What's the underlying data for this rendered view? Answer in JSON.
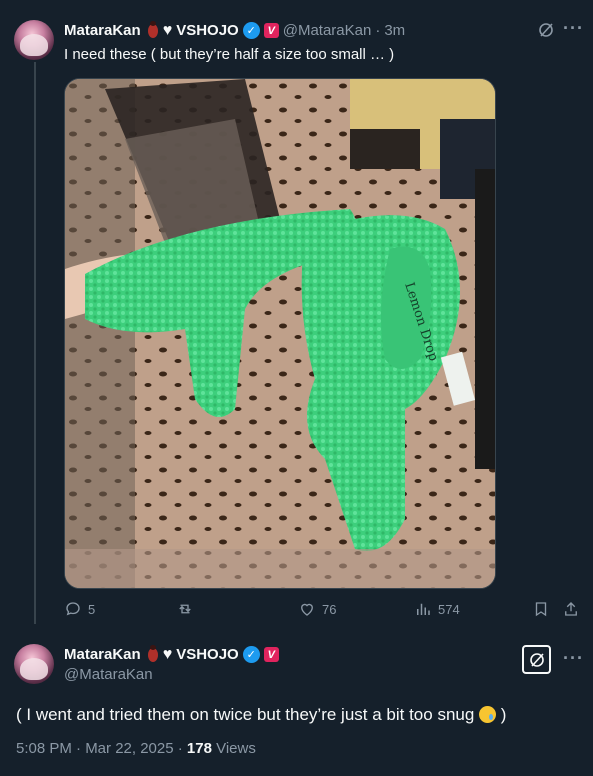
{
  "tweet1": {
    "display_name": "MataraKan",
    "affiliation": "VSHOJO",
    "handle": "@MataraKan",
    "separator": "·",
    "time_ago": "3m",
    "text": "I need these ( but they’re half a size too small … )",
    "badge_v": "V",
    "stats": {
      "replies": "5",
      "likes": "76",
      "views": "574"
    }
  },
  "tweet2": {
    "display_name": "MataraKan",
    "affiliation": "VSHOJO",
    "handle": "@MataraKan",
    "badge_v": "V",
    "text_before": "( I went and tried them on twice but they’re just a bit too snug",
    "text_after": ")",
    "timestamp": "5:08 PM · Mar 22, 2025 · ",
    "views_count": "178",
    "views_label": " Views"
  },
  "icons": {
    "more": "more-horizontal-icon",
    "grok": "grok-icon",
    "reply": "reply-icon",
    "retweet": "retweet-icon",
    "like": "heart-icon",
    "views": "analytics-icon",
    "bookmark": "bookmark-icon",
    "share": "share-icon"
  },
  "colors": {
    "background": "#15202b",
    "text": "#f7f9f9",
    "muted": "#8b98a5",
    "verified": "#1d9bf0"
  }
}
